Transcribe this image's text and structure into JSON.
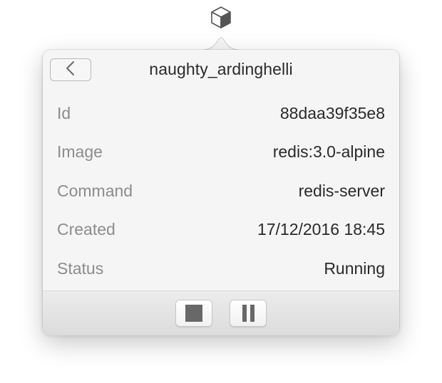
{
  "menubar": {
    "icon": "cube-icon"
  },
  "popover": {
    "title": "naughty_ardinghelli",
    "back_icon": "chevron-left-icon",
    "details": [
      {
        "label": "Id",
        "value": "88daa39f35e8"
      },
      {
        "label": "Image",
        "value": "redis:3.0-alpine"
      },
      {
        "label": "Command",
        "value": "redis-server"
      },
      {
        "label": "Created",
        "value": "17/12/2016 18:45"
      },
      {
        "label": "Status",
        "value": "Running"
      }
    ],
    "controls": {
      "stop_icon": "stop-icon",
      "pause_icon": "pause-icon"
    }
  }
}
